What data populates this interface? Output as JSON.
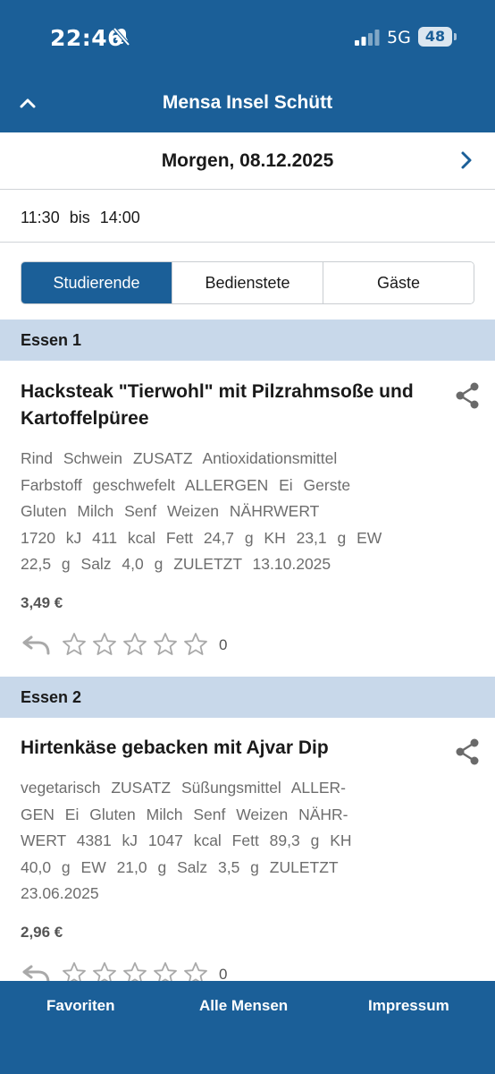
{
  "status_bar": {
    "time": "22:46",
    "network": "5G",
    "battery": "48",
    "icons": [
      "bell-slash-icon",
      "signal-icon"
    ]
  },
  "header": {
    "title": "Mensa Insel Schütt",
    "icons": [
      "chevron-up-icon"
    ]
  },
  "date_bar": {
    "label": "Morgen, 08.12.2025",
    "icons": [
      "chevron-right-icon"
    ]
  },
  "hours": {
    "text": "11:30 bis 14:00"
  },
  "segments": {
    "items": [
      {
        "label": "Studierende",
        "active": true
      },
      {
        "label": "Bedienstete",
        "active": false
      },
      {
        "label": "Gäste",
        "active": false
      }
    ]
  },
  "colors": {
    "brand": "#1b5f98",
    "section_header": "#c8d8ea",
    "muted_text": "#6d6d6d"
  },
  "dishes": [
    {
      "section": "Essen 1",
      "title": "Hacksteak \"Tierwohl\" mit Pilzrahmsoße und Kartoffelpüree",
      "lines": [
        "Rind Schwein ZUSATZ Antioxidationsmittel",
        "Farbstoff geschwefelt ALLERGEN Ei Gerste",
        "Gluten Milch Senf Weizen NÄHRWERT",
        "1720 kJ 411 kcal Fett 24,7 g KH 23,1 g EW",
        "22,5 g Salz 4,0 g ZULETZT 13.10.2025"
      ],
      "price": "3,49 €",
      "rating": 0,
      "rating_count": "0"
    },
    {
      "section": "Essen 2",
      "title": "Hirtenkäse gebacken mit Ajvar Dip",
      "lines": [
        "vegetarisch ZUSATZ Süßungsmittel ALLER-",
        "GEN Ei Gluten Milch Senf Weizen NÄHR-",
        "WERT 4381 kJ 1047 kcal Fett 89,3 g KH",
        "40,0 g EW 21,0 g Salz 3,5 g ZULETZT",
        "23.06.2025"
      ],
      "price": "2,96 €",
      "rating": 0,
      "rating_count": "0"
    }
  ],
  "tab_bar": {
    "items": [
      {
        "label": "Favoriten"
      },
      {
        "label": "Alle Mensen"
      },
      {
        "label": "Impressum"
      }
    ]
  }
}
